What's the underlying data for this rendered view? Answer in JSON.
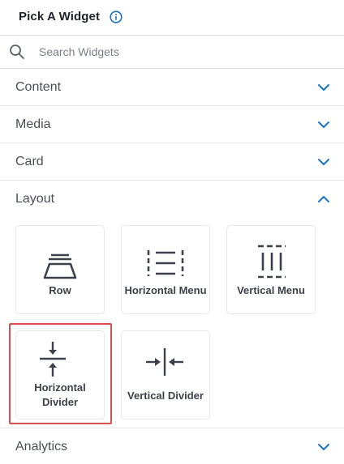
{
  "header": {
    "title": "Pick A Widget",
    "info_icon": "info-circle-icon"
  },
  "search": {
    "placeholder": "Search Widgets",
    "value": "",
    "icon": "search-icon"
  },
  "sections": {
    "content": {
      "label": "Content",
      "expanded": false
    },
    "media": {
      "label": "Media",
      "expanded": false
    },
    "card": {
      "label": "Card",
      "expanded": false
    },
    "layout": {
      "label": "Layout",
      "expanded": true,
      "widgets": {
        "row": {
          "label": "Row",
          "icon": "row-icon"
        },
        "horizontal_menu": {
          "label": "Horizontal Menu",
          "icon": "horizontal-menu-icon"
        },
        "vertical_menu": {
          "label": "Vertical Menu",
          "icon": "vertical-menu-icon"
        },
        "horizontal_divider": {
          "label_line1": "Horizontal",
          "label_line2": "Divider",
          "icon": "horizontal-divider-icon",
          "selected": true
        },
        "vertical_divider": {
          "label": "Vertical Divider",
          "icon": "vertical-divider-icon"
        }
      }
    },
    "analytics": {
      "label": "Analytics",
      "expanded": false
    }
  },
  "colors": {
    "accent": "#1a73c8",
    "selection": "#d9504f",
    "icon": "#3c424b",
    "divider": "#e3e5e8"
  }
}
